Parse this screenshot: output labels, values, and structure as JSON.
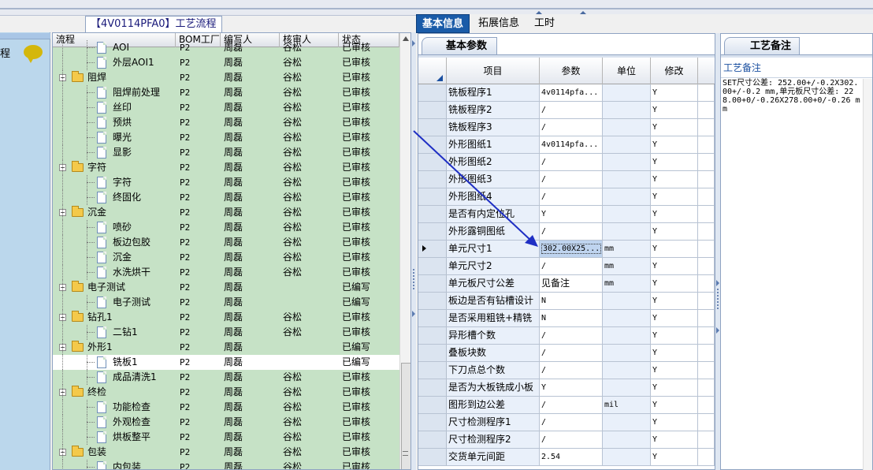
{
  "left_panel": {
    "label": "程"
  },
  "flow": {
    "title": "【4V0114PFA0】工艺流程",
    "columns": [
      "流程",
      "BOM工厂",
      "编写人",
      "核审人",
      "状态"
    ],
    "rows": [
      {
        "name": "AOI",
        "level": 1,
        "type": "doc",
        "bom": "P2",
        "writer": "周磊",
        "reviewer": "谷松",
        "status": "已审核"
      },
      {
        "name": "外层AOI1",
        "level": 1,
        "type": "doc",
        "bom": "P2",
        "writer": "周磊",
        "reviewer": "谷松",
        "status": "已审核"
      },
      {
        "name": "阻焊",
        "level": 0,
        "type": "folder",
        "bom": "P2",
        "writer": "周磊",
        "reviewer": "谷松",
        "status": "已审核"
      },
      {
        "name": "阻焊前处理",
        "level": 1,
        "type": "doc",
        "bom": "P2",
        "writer": "周磊",
        "reviewer": "谷松",
        "status": "已审核"
      },
      {
        "name": "丝印",
        "level": 1,
        "type": "doc",
        "bom": "P2",
        "writer": "周磊",
        "reviewer": "谷松",
        "status": "已审核"
      },
      {
        "name": "预烘",
        "level": 1,
        "type": "doc",
        "bom": "P2",
        "writer": "周磊",
        "reviewer": "谷松",
        "status": "已审核"
      },
      {
        "name": "曝光",
        "level": 1,
        "type": "doc",
        "bom": "P2",
        "writer": "周磊",
        "reviewer": "谷松",
        "status": "已审核"
      },
      {
        "name": "显影",
        "level": 1,
        "type": "doc",
        "bom": "P2",
        "writer": "周磊",
        "reviewer": "谷松",
        "status": "已审核"
      },
      {
        "name": "字符",
        "level": 0,
        "type": "folder",
        "bom": "P2",
        "writer": "周磊",
        "reviewer": "谷松",
        "status": "已审核"
      },
      {
        "name": "字符",
        "level": 1,
        "type": "doc",
        "bom": "P2",
        "writer": "周磊",
        "reviewer": "谷松",
        "status": "已审核"
      },
      {
        "name": "终固化",
        "level": 1,
        "type": "doc",
        "bom": "P2",
        "writer": "周磊",
        "reviewer": "谷松",
        "status": "已审核"
      },
      {
        "name": "沉金",
        "level": 0,
        "type": "folder",
        "bom": "P2",
        "writer": "周磊",
        "reviewer": "谷松",
        "status": "已审核"
      },
      {
        "name": "喷砂",
        "level": 1,
        "type": "doc",
        "bom": "P2",
        "writer": "周磊",
        "reviewer": "谷松",
        "status": "已审核"
      },
      {
        "name": "板边包胶",
        "level": 1,
        "type": "doc",
        "bom": "P2",
        "writer": "周磊",
        "reviewer": "谷松",
        "status": "已审核"
      },
      {
        "name": "沉金",
        "level": 1,
        "type": "doc",
        "bom": "P2",
        "writer": "周磊",
        "reviewer": "谷松",
        "status": "已审核"
      },
      {
        "name": "水洗烘干",
        "level": 1,
        "type": "doc",
        "bom": "P2",
        "writer": "周磊",
        "reviewer": "谷松",
        "status": "已审核"
      },
      {
        "name": "电子测试",
        "level": 0,
        "type": "folder",
        "bom": "P2",
        "writer": "周磊",
        "reviewer": "",
        "status": "已编写"
      },
      {
        "name": "电子测试",
        "level": 1,
        "type": "doc",
        "bom": "P2",
        "writer": "周磊",
        "reviewer": "",
        "status": "已编写"
      },
      {
        "name": "钻孔1",
        "level": 0,
        "type": "folder",
        "bom": "P2",
        "writer": "周磊",
        "reviewer": "谷松",
        "status": "已审核"
      },
      {
        "name": "二钻1",
        "level": 1,
        "type": "doc",
        "bom": "P2",
        "writer": "周磊",
        "reviewer": "谷松",
        "status": "已审核"
      },
      {
        "name": "外形1",
        "level": 0,
        "type": "folder",
        "bom": "P2",
        "writer": "周磊",
        "reviewer": "",
        "status": "已编写"
      },
      {
        "name": "铣板1",
        "level": 1,
        "type": "doc",
        "bom": "P2",
        "writer": "周磊",
        "reviewer": "",
        "status": "已编写",
        "selected": true
      },
      {
        "name": "成品清洗1",
        "level": 1,
        "type": "doc",
        "bom": "P2",
        "writer": "周磊",
        "reviewer": "谷松",
        "status": "已审核"
      },
      {
        "name": "终检",
        "level": 0,
        "type": "folder",
        "bom": "P2",
        "writer": "周磊",
        "reviewer": "谷松",
        "status": "已审核"
      },
      {
        "name": "功能检查",
        "level": 1,
        "type": "doc",
        "bom": "P2",
        "writer": "周磊",
        "reviewer": "谷松",
        "status": "已审核"
      },
      {
        "name": "外观检查",
        "level": 1,
        "type": "doc",
        "bom": "P2",
        "writer": "周磊",
        "reviewer": "谷松",
        "status": "已审核"
      },
      {
        "name": "烘板整平",
        "level": 1,
        "type": "doc",
        "bom": "P2",
        "writer": "周磊",
        "reviewer": "谷松",
        "status": "已审核"
      },
      {
        "name": "包装",
        "level": 0,
        "type": "folder",
        "bom": "P2",
        "writer": "周磊",
        "reviewer": "谷松",
        "status": "已审核"
      },
      {
        "name": "内包装",
        "level": 1,
        "type": "doc",
        "bom": "P2",
        "writer": "周磊",
        "reviewer": "谷松",
        "status": "已审核"
      }
    ]
  },
  "tabs": [
    "基本信息",
    "拓展信息",
    "工时"
  ],
  "params": {
    "subtab": "基本参数",
    "columns": [
      "项目",
      "参数",
      "单位",
      "修改"
    ],
    "rows": [
      {
        "item": "铣板程序1",
        "value": "4v0114pfa...",
        "unit": "",
        "modify": "Y"
      },
      {
        "item": "铣板程序2",
        "value": "/",
        "unit": "",
        "modify": "Y"
      },
      {
        "item": "铣板程序3",
        "value": "/",
        "unit": "",
        "modify": "Y"
      },
      {
        "item": "外形图纸1",
        "value": "4v0114pfa...",
        "unit": "",
        "modify": "Y"
      },
      {
        "item": "外形图纸2",
        "value": "/",
        "unit": "",
        "modify": "Y"
      },
      {
        "item": "外形图纸3",
        "value": "/",
        "unit": "",
        "modify": "Y"
      },
      {
        "item": "外形图纸4",
        "value": "/",
        "unit": "",
        "modify": "Y"
      },
      {
        "item": "是否有内定位孔",
        "value": "Y",
        "unit": "",
        "modify": "Y"
      },
      {
        "item": "外形露铜图纸",
        "value": "/",
        "unit": "",
        "modify": "Y"
      },
      {
        "item": "单元尺寸1",
        "value": "302.00X25...",
        "unit": "mm",
        "modify": "Y",
        "current": true
      },
      {
        "item": "单元尺寸2",
        "value": "/",
        "unit": "mm",
        "modify": "Y"
      },
      {
        "item": "单元板尺寸公差",
        "value": "见备注",
        "unit": "mm",
        "modify": "Y"
      },
      {
        "item": "板边是否有钻槽设计",
        "value": "N",
        "unit": "",
        "modify": "Y"
      },
      {
        "item": "是否采用粗铣+精铣",
        "value": "N",
        "unit": "",
        "modify": "Y"
      },
      {
        "item": "异形槽个数",
        "value": "/",
        "unit": "",
        "modify": "Y"
      },
      {
        "item": "叠板块数",
        "value": "/",
        "unit": "",
        "modify": "Y"
      },
      {
        "item": "下刀点总个数",
        "value": "/",
        "unit": "",
        "modify": "Y"
      },
      {
        "item": "是否为大板铣成小板",
        "value": "Y",
        "unit": "",
        "modify": "Y"
      },
      {
        "item": "图形到边公差",
        "value": "/",
        "unit": "mil",
        "modify": "Y"
      },
      {
        "item": "尺寸检测程序1",
        "value": "/",
        "unit": "",
        "modify": "Y"
      },
      {
        "item": "尺寸检测程序2",
        "value": "/",
        "unit": "",
        "modify": "Y"
      },
      {
        "item": "交货单元间距",
        "value": "2.54",
        "unit": "",
        "modify": "Y"
      }
    ]
  },
  "notes": {
    "tab": "工艺备注",
    "header": "工艺备注",
    "text": "SET尺寸公差: 252.00+/-0.2X302.00+/-0.2 mm,单元板尺寸公差: 228.00+0/-0.26X278.00+0/-0.26 mm"
  },
  "colors": {
    "tree_bg": "#c6e2c6",
    "tab_active": "#1a5ba8",
    "annotation_arrow": "#1f2fc4"
  }
}
